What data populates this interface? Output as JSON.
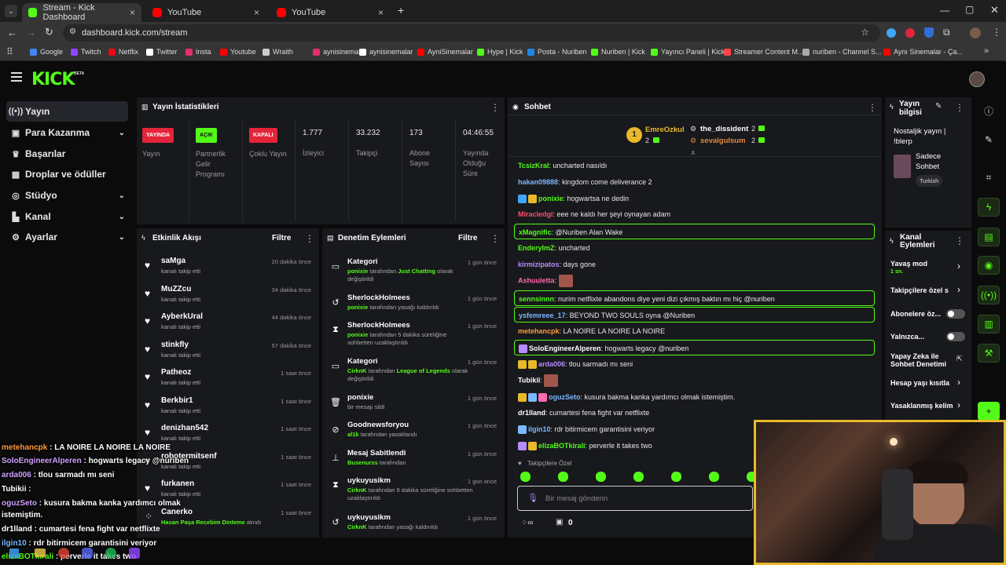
{
  "browser": {
    "tabs": [
      {
        "title": "Stream - Kick Dashboard",
        "favicon": "kick"
      },
      {
        "title": "YouTube",
        "favicon": "youtube"
      },
      {
        "title": "YouTube",
        "favicon": "youtube"
      }
    ],
    "new_tab": "+",
    "url": "dashboard.kick.com/stream",
    "bookmarks": [
      {
        "label": "Google",
        "color": "#4285f4"
      },
      {
        "label": "Twitch",
        "color": "#9146ff"
      },
      {
        "label": "Netflix",
        "color": "#e50914"
      },
      {
        "label": "Twitter",
        "color": "#ffffff"
      },
      {
        "label": "Insta",
        "color": "#e1306c"
      },
      {
        "label": "Youtube",
        "color": "#ff0000"
      },
      {
        "label": "Wraith",
        "color": "#cccccc"
      },
      {
        "label": "aynisinemalar",
        "color": "#e1306c"
      },
      {
        "label": "aynisinemalar",
        "color": "#ffffff"
      },
      {
        "label": "AyniSinemalar",
        "color": "#ff0000"
      },
      {
        "label": "Hype | Kick",
        "color": "#53fc18"
      },
      {
        "label": "Posta - Nuriben",
        "color": "#1e88e5"
      },
      {
        "label": "Nuriben | Kick",
        "color": "#53fc18"
      },
      {
        "label": "Yayıncı Paneli | Kick",
        "color": "#53fc18"
      },
      {
        "label": "Streamer Content M...",
        "color": "#ff4444"
      },
      {
        "label": "nuriben - Channel S...",
        "color": "#aaaaaa"
      },
      {
        "label": "Aynı Sinemalar - Ça...",
        "color": "#ff0000"
      }
    ]
  },
  "kick": {
    "logo": "KICK",
    "beta": "BETA"
  },
  "sidebar": {
    "items": [
      {
        "label": "Yayın",
        "icon": "stream-icon"
      },
      {
        "label": "Para Kazanma",
        "icon": "wallet-icon"
      },
      {
        "label": "Başarılar",
        "icon": "trophy-icon"
      },
      {
        "label": "Droplar ve ödüller",
        "icon": "gift-icon"
      },
      {
        "label": "Stüdyo",
        "icon": "studio-icon"
      },
      {
        "label": "Kanal",
        "icon": "channel-icon"
      },
      {
        "label": "Ayarlar",
        "icon": "gear-icon"
      }
    ]
  },
  "stats": {
    "title": "Yayın İstatistikleri",
    "items": [
      {
        "badge": "YAYINDA",
        "badge_color": "#e3243b",
        "label": "Yayın"
      },
      {
        "badge": "AÇIK",
        "badge_color": "#53fc18",
        "label": "Partnerlik Gelir Programı"
      },
      {
        "badge": "KAPALI",
        "badge_color": "#e3243b",
        "label": "Çoklu Yayın"
      },
      {
        "value": "1.777",
        "label": "İzleyici"
      },
      {
        "value": "33.232",
        "label": "Takipçi"
      },
      {
        "value": "173",
        "label": "Abone Sayısı"
      },
      {
        "value": "04:46:55",
        "label": "Yayında Olduğu Süre"
      }
    ]
  },
  "events": {
    "title": "Etkinlik Akışı",
    "filter": "Filtre",
    "items": [
      {
        "name": "saMga",
        "sub": "kanalı takip etti",
        "time": "20 dakika önce"
      },
      {
        "name": "MuZZcu",
        "sub": "kanalı takip etti",
        "time": "34 dakika önce"
      },
      {
        "name": "AyberkUral",
        "sub": "kanalı takip etti",
        "time": "44 dakika önce"
      },
      {
        "name": "stinkfly",
        "sub": "kanalı takip etti",
        "time": "57 dakika önce"
      },
      {
        "name": "Patheoz",
        "sub": "kanalı takip etti",
        "time": "1 saat önce"
      },
      {
        "name": "Berkbir1",
        "sub": "kanalı takip etti",
        "time": "1 saat önce"
      },
      {
        "name": "denizhan542",
        "sub": "kanalı takip etti",
        "time": "1 saat önce"
      },
      {
        "name": "robotermitsenf",
        "sub": "kanalı takip etti",
        "time": "1 saat önce"
      },
      {
        "name": "furkanen",
        "sub": "kanalı takip etti",
        "time": "1 saat önce"
      },
      {
        "name": "Canerko",
        "sub_green": "Hasan Paşa Recebim Dinleme",
        "sub": "alındı",
        "time": "1 saat önce"
      }
    ]
  },
  "moderation": {
    "title": "Denetim Eylemleri",
    "filter": "Filtre",
    "items": [
      {
        "icon": "category-icon",
        "glyph": "▭",
        "name": "Kategori",
        "actor": "ponixie",
        "mid": "tarafından",
        "target": "Just Chatting",
        "tail": "olarak değiştirildi",
        "time": "1 gün önce"
      },
      {
        "icon": "unban-icon",
        "glyph": "↺",
        "name": "SherlockHolmees",
        "actor": "ponixie",
        "mid": "tarafından yasağı kaldırıldı",
        "target": "",
        "tail": "",
        "time": "1 gün önce"
      },
      {
        "icon": "timeout-icon",
        "glyph": "⧗",
        "name": "SherlockHolmees",
        "actor": "ponixie",
        "mid": "tarafından 5 dakika süreliğine sohbetten uzaklaştırıldı",
        "target": "",
        "tail": "",
        "time": "1 gün önce"
      },
      {
        "icon": "category-icon",
        "glyph": "▭",
        "name": "Kategori",
        "actor": "CirknK",
        "mid": "tarafından",
        "target": "League of Legends",
        "tail": "olarak değiştirildi",
        "time": "1 gün önce"
      },
      {
        "icon": "trash-icon",
        "glyph": "🗑",
        "name": "ponixie",
        "actor": "",
        "mid": "bir mesajı sildi",
        "target": "",
        "tail": "",
        "time": "1 gün önce"
      },
      {
        "icon": "ban-icon",
        "glyph": "⊘",
        "name": "Goodnewsforyou",
        "actor": "al1k",
        "mid": "tarafından yasaklandı",
        "target": "",
        "tail": "",
        "time": "1 gün önce"
      },
      {
        "icon": "pin-icon",
        "glyph": "⊥",
        "name": "Mesaj Sabitlendi",
        "actor": "Busenurss",
        "mid": "tarafından",
        "target": "",
        "tail": "",
        "time": "1 gün önce"
      },
      {
        "icon": "timeout-icon",
        "glyph": "⧗",
        "name": "uykuyusikm",
        "actor": "CirknK",
        "mid": "tarafından 9 dakika süreliğine sohbetten uzaklaştırıldı",
        "target": "",
        "tail": "",
        "time": "1 gün önce"
      },
      {
        "icon": "unban-icon",
        "glyph": "↺",
        "name": "uykuyusikm",
        "actor": "CirknK",
        "mid": "tarafından yasağı kaldırıldı",
        "target": "",
        "tail": "",
        "time": "1 gün önce"
      }
    ]
  },
  "chat": {
    "title": "Sohbet",
    "top_gifters": [
      {
        "name": "EmreOzkul",
        "count": "2"
      },
      {
        "name": "the_dissident",
        "count": "2"
      },
      {
        "name": "sevalgulsum",
        "count": "2"
      }
    ],
    "messages": [
      {
        "user": "TcsizKral",
        "color": "#53fc18",
        "text": "uncharted nasıldı",
        "hl": false
      },
      {
        "user": "hakan09888",
        "color": "#7ab8ff",
        "text": "kingdom come deliverance 2",
        "hl": false
      },
      {
        "user": "ponixie",
        "color": "#53fc18",
        "text": "hogwartsa ne dedin",
        "hl": false
      },
      {
        "user": "Miracledgi",
        "color": "#ff4c6e",
        "text": "eee ne kaldı her şeyi oynayan adam",
        "hl": false
      },
      {
        "user": "xMagnific",
        "color": "#53fc18",
        "text": "@Nuriben Alan Wake",
        "hl": true
      },
      {
        "user": "EnderyImZ",
        "color": "#53fc18",
        "text": "uncharted",
        "hl": false
      },
      {
        "user": "kirmizipatos",
        "color": "#b58cff",
        "text": "days gone",
        "hl": false
      },
      {
        "user": "Ashuuletta",
        "color": "#ff6ab0",
        "text": "",
        "hl": false
      },
      {
        "user": "sennsinnn",
        "color": "#53fc18",
        "text": "nurim netflixte abandons diye yeni dizi çıkmış baktın mı hiç @nuriben",
        "hl": true
      },
      {
        "user": "ysfemreee_17",
        "color": "#7ab8ff",
        "text": "BEYOND TWO SOULS oyna @Nuriben",
        "hl": true
      },
      {
        "user": "metehancpk",
        "color": "#ff9a3c",
        "text": "LA NOIRE LA NOIRE LA NOIRE",
        "hl": false
      },
      {
        "user": "SoloEngineerAlperen",
        "color": "#ffffff",
        "text": "hogwarts legacy @nuriben",
        "hl": true
      },
      {
        "user": "arda006",
        "color": "#b58cff",
        "text": "tlou sarmadı mı seni",
        "hl": false
      },
      {
        "user": "Tubikii",
        "color": "#ffffff",
        "text": "",
        "hl": false
      },
      {
        "user": "oguzSeto",
        "color": "#7ab8ff",
        "text": "kusura bakma kanka yardımcı olmak istemiştim.",
        "hl": false
      },
      {
        "user": "dr1lland",
        "color": "#ffffff",
        "text": "cumartesi fena fight var netflixte",
        "hl": false
      },
      {
        "user": "ilgin10",
        "color": "#7ab8ff",
        "text": "rdr bitirmicem garantisini veriyor",
        "hl": false
      },
      {
        "user": "elizaBOTkirali",
        "color": "#53fc18",
        "text": "perverle it takes two",
        "hl": false
      }
    ],
    "followers_only": "Takipçilere Özel",
    "input_placeholder": "Bir mesaj gönderin",
    "points": "0"
  },
  "stream_info": {
    "title": "Yayın bilgisi",
    "stream_title": "Nostaljik yayın | !blerp",
    "category": "Sadece Sohbet",
    "language": "Turkish"
  },
  "channel_actions": {
    "title": "Kanal Eylemleri",
    "slow_mode": "Yavaş mod",
    "slow_mode_value": "1 sn.",
    "followers": "Takipçilere özel s",
    "subscribers": "Abonelere öz...",
    "emotes_only": "Yalnızca...",
    "ai_moderation": "Yapay Zeka ile Sohbet Denetimi",
    "account_age": "Hesap yaşı kısıtla",
    "banned_words": "Yasaklanmış kelim"
  },
  "overlay": {
    "lines": [
      {
        "user": "metehancpk",
        "text": " : LA NOIRE LA NOIRE LA NOIRE",
        "color": "#ff9a3c"
      },
      {
        "user": "SoloEngineerAlperen",
        "text": " : hogwarts legacy @nuriben",
        "color": "#d0a0ff"
      },
      {
        "user": "arda006",
        "text": " : tlou sarmadı mı seni",
        "color": "#d0a0ff"
      },
      {
        "user": "Tubikii",
        "text": " :",
        "color": "#ffffff"
      },
      {
        "user": "oguzSeto",
        "text": " : kusura bakma kanka yardımcı olmak",
        "color": "#d0a0ff"
      },
      {
        "user": "",
        "text": "istemiştim.",
        "color": "#ffffff"
      },
      {
        "user": "dr1lland",
        "text": " : cumartesi fena fight var netflixte",
        "color": "#ffffff"
      },
      {
        "user": "ilgin10",
        "text": " : rdr bitirmicem garantisini veriyor",
        "color": "#7ab8ff"
      },
      {
        "user": "elizaBOTkirali",
        "text": " : perverle it takes two",
        "color": "#53fc18"
      }
    ]
  }
}
